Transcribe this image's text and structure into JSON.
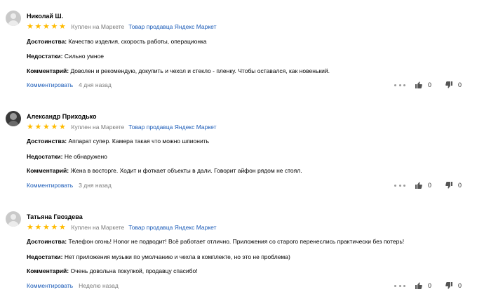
{
  "reviews": [
    {
      "author": "Николай Ш.",
      "rating": 5,
      "bought": "Куплен на Маркете",
      "seller": "Товар продавца Яндекс Маркет",
      "pros_label": "Достоинства:",
      "pros": "Качество изделия, скорость работы, операционка",
      "cons_label": "Недостатки:",
      "cons": "Сильно умное",
      "comment_label": "Комментарий:",
      "comment": "Доволен и рекомендую, докупить и чехол и стекло - пленку. Чтобы оставался, как новенький.",
      "comment_link": "Комментировать",
      "date": "4 дня назад",
      "likes": "0",
      "dislikes": "0",
      "avatar": "default-avatar-icon"
    },
    {
      "author": "Александр Приходько",
      "rating": 5,
      "bought": "Куплен на Маркете",
      "seller": "Товар продавца Яндекс Маркет",
      "pros_label": "Достоинства:",
      "pros": "Аппарат супер. Камера такая что можно шпионить",
      "cons_label": "Недостатки:",
      "cons": "Не обнаружено",
      "comment_label": "Комментарий:",
      "comment": "Жена в восторге. Ходит и фоткает объекты в дали. Говорит айфон рядом не стоял.",
      "comment_link": "Комментировать",
      "date": "3 дня назад",
      "likes": "0",
      "dislikes": "0",
      "avatar": "photo-avatar"
    },
    {
      "author": "Татьяна Гвоздева",
      "rating": 5,
      "bought": "Куплен на Маркете",
      "seller": "Товар продавца Яндекс Маркет",
      "pros_label": "Достоинства:",
      "pros": "Телефон огонь! Honor не подводит! Всё работает отлично. Приложения со старого перенеслись практически без потерь!",
      "cons_label": "Недостатки:",
      "cons": "Нет приложения музыки по умолчанию и чехла в комплекте, но это не проблема)",
      "comment_label": "Комментарий:",
      "comment": "Очень довольна покупкой, продавцу спасибо!",
      "comment_link": "Комментировать",
      "date": "Неделю назад",
      "likes": "0",
      "dislikes": "0",
      "avatar": "default-avatar-icon"
    }
  ],
  "colors": {
    "star": "#ffbb00",
    "link": "#1a5bb8",
    "muted": "#7a7a7a"
  }
}
